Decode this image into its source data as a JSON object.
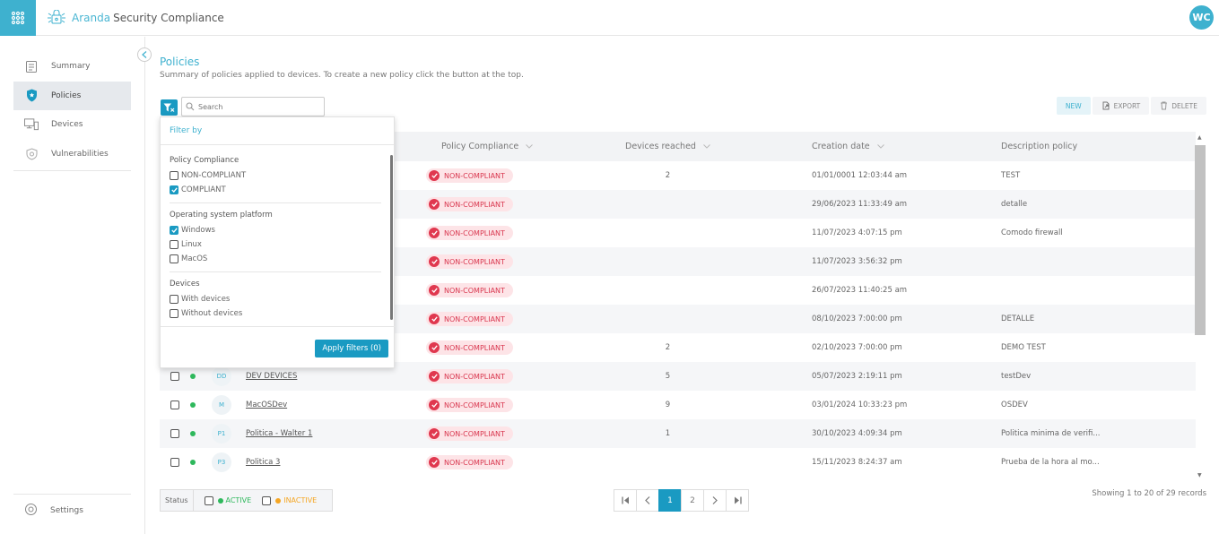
{
  "app": {
    "brand_light": "Aranda",
    "brand_bold": "Security Compliance",
    "user_initials": "WC",
    "accent_color": "#3eb1cf",
    "primary_button_color": "#1a9ac2"
  },
  "sidebar": {
    "items": [
      {
        "label": "Summary",
        "icon": "report-icon",
        "active": false
      },
      {
        "label": "Policies",
        "icon": "shield-star-icon",
        "active": true
      },
      {
        "label": "Devices",
        "icon": "devices-icon",
        "active": false
      },
      {
        "label": "Vulnerabilities",
        "icon": "shield-outline-icon",
        "active": false
      }
    ],
    "settings_label": "Settings"
  },
  "page": {
    "title": "Policies",
    "subtitle": "Summary of policies applied to devices. To create a new policy click the button at the top."
  },
  "search": {
    "placeholder": "Search"
  },
  "toolbar": {
    "new_label": "NEW",
    "export_label": "EXPORT",
    "delete_label": "DELETE"
  },
  "filter_panel": {
    "heading": "Filter by",
    "sections": [
      {
        "title": "Policy Compliance",
        "options": [
          {
            "label": "NON-COMPLIANT",
            "checked": false
          },
          {
            "label": "COMPLIANT",
            "checked": true
          }
        ]
      },
      {
        "title": "Operating system platform",
        "options": [
          {
            "label": "Windows",
            "checked": true
          },
          {
            "label": "Linux",
            "checked": false
          },
          {
            "label": "MacOS",
            "checked": false
          }
        ]
      },
      {
        "title": "Devices",
        "options": [
          {
            "label": "With devices",
            "checked": false
          },
          {
            "label": "Without devices",
            "checked": false
          }
        ]
      }
    ],
    "apply_label": "Apply filters (0)"
  },
  "table": {
    "columns": [
      "Policy Compliance",
      "Devices reached",
      "Creation date",
      "Description policy"
    ],
    "rows": [
      {
        "initials": "",
        "name": "",
        "compliance": "NON-COMPLIANT",
        "devices": "2",
        "date": "01/01/0001 12:03:44 am",
        "desc": "TEST"
      },
      {
        "initials": "",
        "name": "",
        "compliance": "NON-COMPLIANT",
        "devices": "",
        "date": "29/06/2023 11:33:49 am",
        "desc": "detalle"
      },
      {
        "initials": "",
        "name": "",
        "compliance": "NON-COMPLIANT",
        "devices": "",
        "date": "11/07/2023 4:07:15 pm",
        "desc": "Comodo firewall"
      },
      {
        "initials": "",
        "name": "",
        "compliance": "NON-COMPLIANT",
        "devices": "",
        "date": "11/07/2023 3:56:32 pm",
        "desc": ""
      },
      {
        "initials": "",
        "name": "",
        "compliance": "NON-COMPLIANT",
        "devices": "",
        "date": "26/07/2023 11:40:25 am",
        "desc": ""
      },
      {
        "initials": "",
        "name": "",
        "compliance": "NON-COMPLIANT",
        "devices": "",
        "date": "08/10/2023 7:00:00 pm",
        "desc": "DETALLE"
      },
      {
        "initials": "",
        "name": "",
        "compliance": "NON-COMPLIANT",
        "devices": "2",
        "date": "02/10/2023 7:00:00 pm",
        "desc": "DEMO TEST"
      },
      {
        "initials": "DD",
        "name": "DEV DEVICES",
        "compliance": "NON-COMPLIANT",
        "devices": "5",
        "date": "05/07/2023 2:19:11 pm",
        "desc": "testDev"
      },
      {
        "initials": "M",
        "name": "MacOSDev",
        "compliance": "NON-COMPLIANT",
        "devices": "9",
        "date": "03/01/2024 10:33:23 pm",
        "desc": "OSDEV"
      },
      {
        "initials": "P1",
        "name": "Politica - Walter 1",
        "compliance": "NON-COMPLIANT",
        "devices": "1",
        "date": "30/10/2023 4:09:34 pm",
        "desc": "Politica minima de verifi..."
      },
      {
        "initials": "P3",
        "name": "Politica 3",
        "compliance": "NON-COMPLIANT",
        "devices": "",
        "date": "15/11/2023 8:24:37 am",
        "desc": "Prueba de la hora al mo..."
      }
    ]
  },
  "status_filter": {
    "label": "Status",
    "active_label": "ACTIVE",
    "inactive_label": "INACTIVE",
    "active_color": "#2eb85c",
    "inactive_color": "#f5a623"
  },
  "pagination": {
    "pages": [
      "1",
      "2"
    ],
    "current": "1"
  },
  "records_text": "Showing 1 to 20 of 29 records"
}
